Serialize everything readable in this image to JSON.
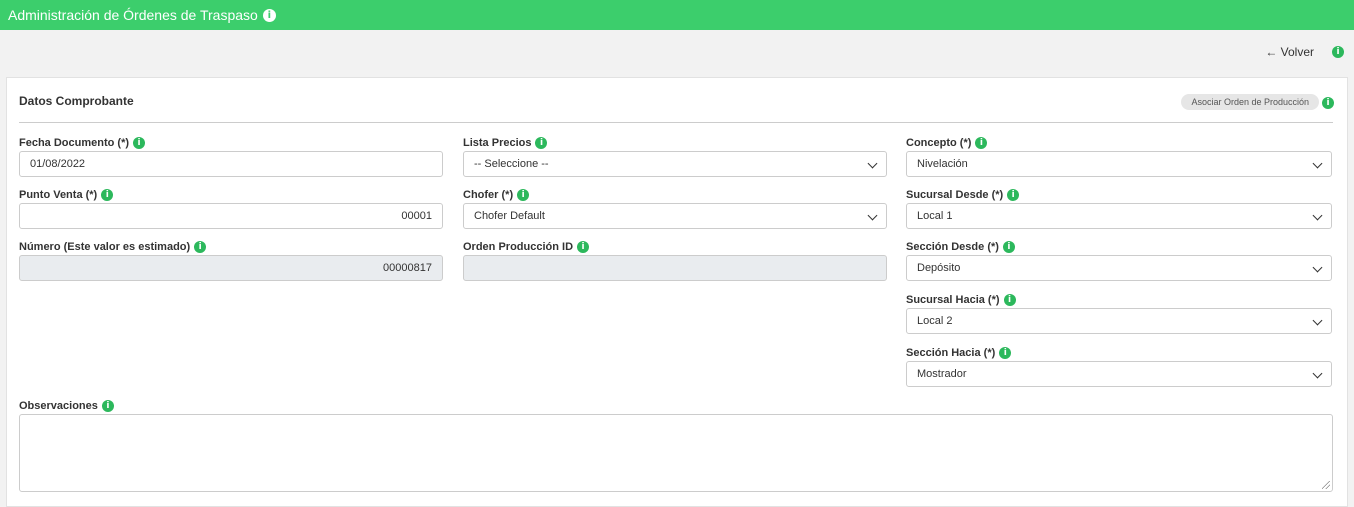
{
  "header": {
    "title": "Administración de Órdenes de Traspaso",
    "info_icon": "info-icon"
  },
  "toolbar": {
    "volver_label": "← Volver"
  },
  "card": {
    "title": "Datos Comprobante",
    "assoc_button": "Asociar Orden de Producción"
  },
  "fields": {
    "fecha": {
      "label": "Fecha Documento (*)",
      "value": "01/08/2022"
    },
    "punto": {
      "label": "Punto Venta (*)",
      "value": "00001"
    },
    "numero": {
      "label": "Número (Este valor es estimado)",
      "value": "00000817"
    },
    "lista": {
      "label": "Lista Precios",
      "value": "-- Seleccione --"
    },
    "chofer": {
      "label": "Chofer (*)",
      "value": "Chofer Default"
    },
    "orden": {
      "label": "Orden Producción ID",
      "value": ""
    },
    "concepto": {
      "label": "Concepto (*)",
      "value": "Nivelación"
    },
    "suc_desde": {
      "label": "Sucursal Desde (*)",
      "value": "Local 1"
    },
    "sec_desde": {
      "label": "Sección Desde (*)",
      "value": "Depósito"
    },
    "suc_hacia": {
      "label": "Sucursal Hacia (*)",
      "value": "Local 2"
    },
    "sec_hacia": {
      "label": "Sección Hacia (*)",
      "value": "Mostrador"
    },
    "obs": {
      "label": "Observaciones",
      "value": ""
    }
  },
  "colors": {
    "accent": "#3cce6c",
    "info": "#2cb85c"
  }
}
